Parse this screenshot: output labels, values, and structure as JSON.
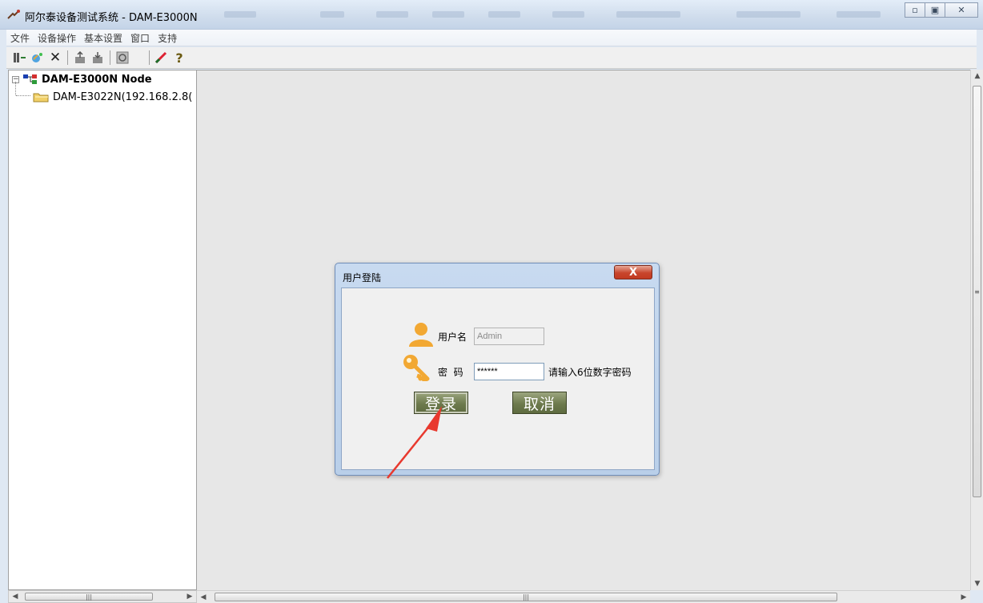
{
  "window": {
    "title": "阿尔泰设备测试系统 - DAM-E3000N"
  },
  "menu": {
    "items": [
      "文件",
      "设备操作",
      "基本设置",
      "窗口",
      "支持"
    ]
  },
  "toolbar": {
    "icons": [
      "connect-icon",
      "search-device-icon",
      "disconnect-icon",
      "upload-icon",
      "download-icon",
      "settings-icon",
      "edit-icon",
      "help-icon"
    ]
  },
  "tree": {
    "root_label": "DAM-E3000N Node",
    "child_label": "DAM-E3022N(192.168.2.8("
  },
  "dialog": {
    "title": "用户登陆",
    "close_label": "X",
    "username_label": "用户名",
    "username_value": "Admin",
    "password_label": "密  码",
    "password_value": "******",
    "password_hint": "请输入6位数字密码",
    "login_label": "登录",
    "cancel_label": "取消"
  },
  "colors": {
    "annotation_arrow": "#e8392e",
    "dialog_button": "#6d7a4d",
    "close_button": "#c8452c"
  }
}
